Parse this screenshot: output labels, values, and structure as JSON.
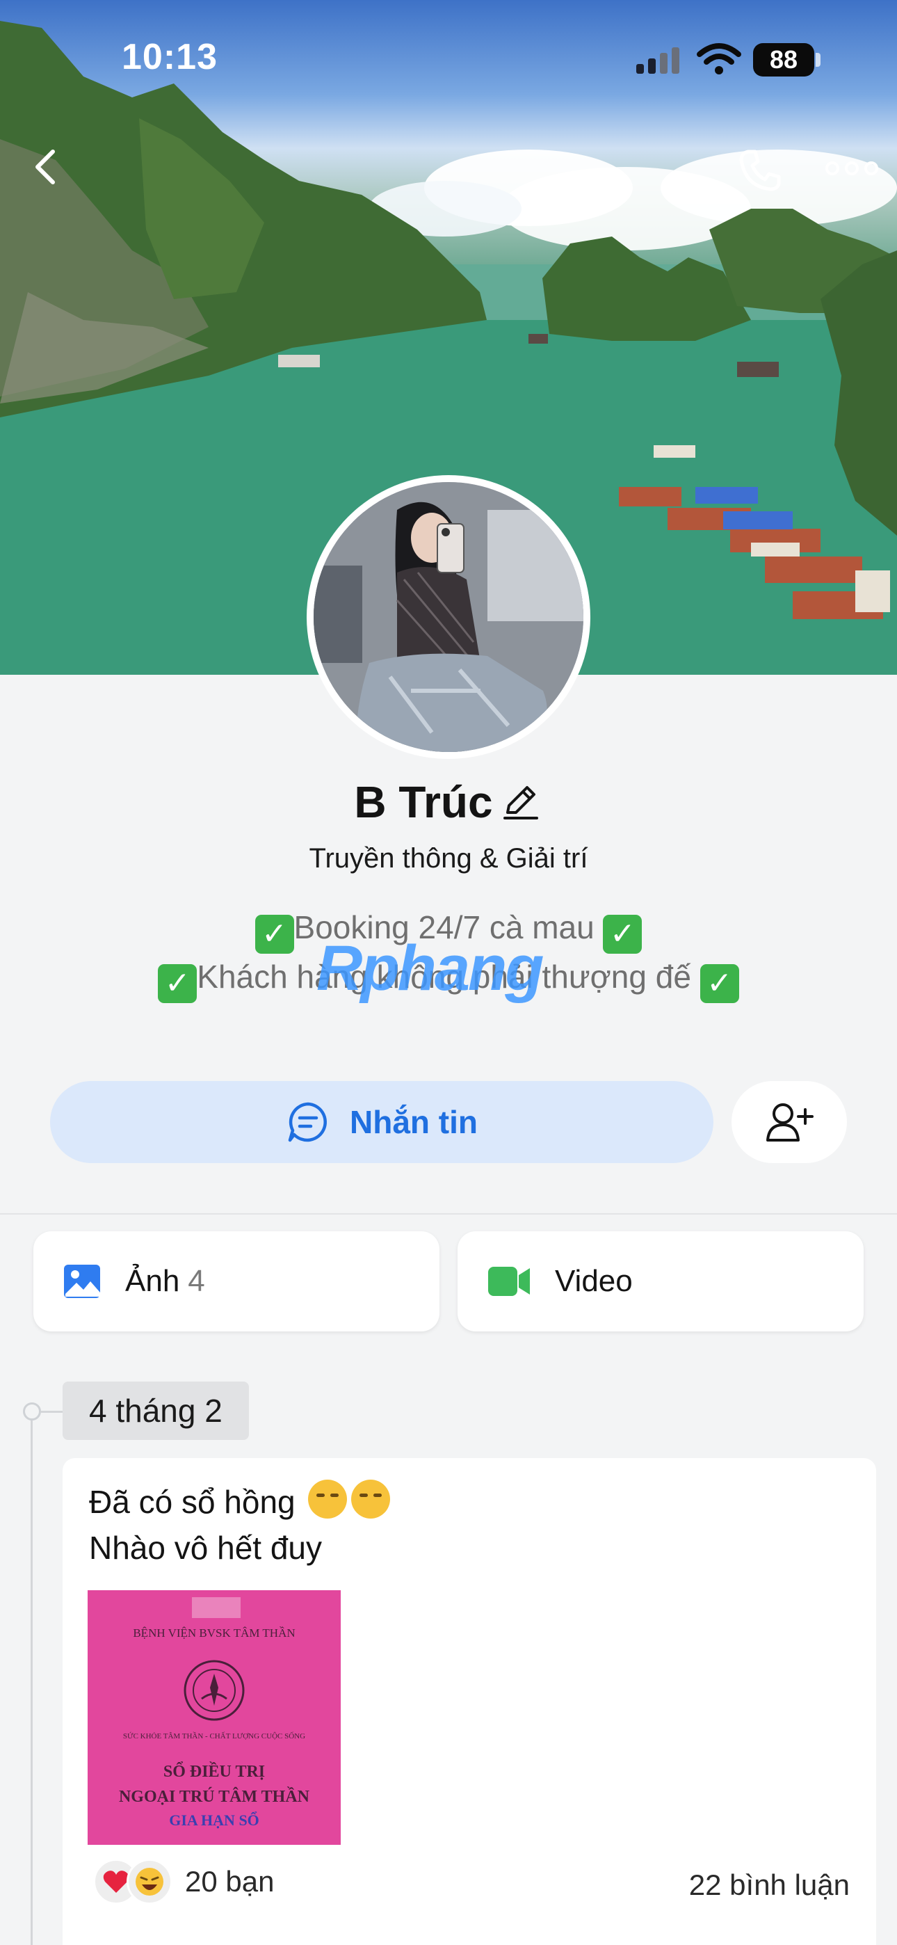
{
  "status_bar": {
    "time": "10:13",
    "battery": "88"
  },
  "profile": {
    "name": "B Trúc",
    "category": "Truyền thông & Giải trí",
    "bio_lines": [
      "Booking 24/7 cà mau",
      "Khách hàng không phải thượng đế"
    ]
  },
  "watermark": "Rphang",
  "actions": {
    "message_label": "Nhắn tin"
  },
  "media": {
    "photos_label": "Ảnh",
    "photos_count": "4",
    "videos_label": "Video"
  },
  "timeline": {
    "date": "4 tháng 2",
    "post": {
      "line1": "Đã có sổ hồng",
      "line2": "Nhào vô hết đuy",
      "image_text": {
        "hospital": "BỆNH VIỆN BVSK TÂM THẦN",
        "motto": "SỨC KHỎE TÂM THẦN - CHẤT LƯỢNG CUỘC SỐNG",
        "title1": "SỔ ĐIỀU TRỊ",
        "title2": "NGOẠI TRÚ TÂM THẦN",
        "stamp": "GIA HẠN SỔ"
      },
      "reactions_label": "20 bạn",
      "comments_label": "22 bình luận"
    }
  },
  "colors": {
    "accent": "#1f6fe0",
    "accent_bg": "#dbe8fb",
    "video_green": "#3dba5a",
    "check_green": "#3cb34a",
    "booklet_pink": "#e2479d"
  },
  "icons": [
    "back-chevron-icon",
    "phone-icon",
    "more-icon",
    "edit-pencil-icon",
    "chat-bubble-icon",
    "add-friend-icon",
    "image-icon",
    "video-camera-icon",
    "heart-reaction-icon",
    "laugh-reaction-icon"
  ]
}
